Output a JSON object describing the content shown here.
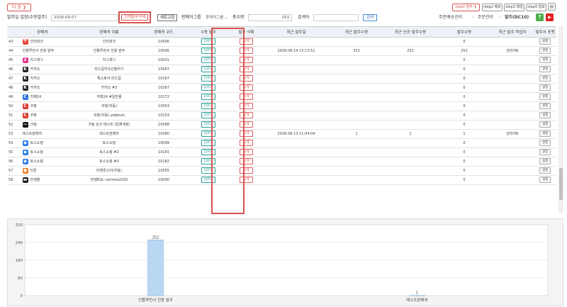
{
  "topbar": {
    "next_label": "다 음 ❯",
    "steps": [
      {
        "label": "step1 발주 ⬆",
        "active": true
      },
      {
        "label": "step2 메모",
        "active": false
      },
      {
        "label": "step3 매칭",
        "active": false
      },
      {
        "label": "step4 합포",
        "active": false
      }
    ]
  },
  "filter": {
    "date_label": "발주일 설정(수동발주)",
    "date_value": "2026-09-07",
    "delete_all_label": "전체발주삭제",
    "refresh_label": "새로고침",
    "group_label": "판매처그룹",
    "group_value": "판매처그룹 ⌄",
    "total_label": "총수량",
    "total_value": "253",
    "search_label": "검색어",
    "search_value": "",
    "search_button": "검색"
  },
  "breadcrumb": {
    "item1": "주문배송관리",
    "sep1": "›",
    "item2": "주문관리",
    "sep2": "›",
    "item3": "발주(DC10)"
  },
  "table": {
    "headers": [
      "판매처",
      "판매처 이름",
      "판매처 코드",
      "수동 발주",
      "발주 삭제",
      "최근 발주일",
      "최근 발주수량",
      "최근 신규 발주수량",
      "발주수량",
      "최근 발주 작업자",
      "발주서 포맷"
    ],
    "upload_label": "업로드",
    "delete_label": "삭제",
    "setting_label": "설정",
    "rows": [
      {
        "no": "43",
        "channel": "인터파크",
        "icon": "interpark-icon",
        "name": "인터파크",
        "code": "10006",
        "date": "",
        "recent": "",
        "new": "",
        "qty": "0",
        "worker": "",
        "color": "#e8473b",
        "glyph": "〒"
      },
      {
        "no": "44",
        "channel": "인플루먼서 전용 발주",
        "icon": "blank-icon",
        "name": "인플루먼서 전용 발주",
        "code": "10095",
        "date": "2026-08-14 13:13:51",
        "recent": "252",
        "new": "252",
        "qty": "252",
        "worker": "관리자6",
        "color": "",
        "glyph": ""
      },
      {
        "no": "45",
        "channel": "지그재그",
        "icon": "zigzag-icon",
        "name": "지그재그",
        "code": "10031",
        "date": "",
        "recent": "",
        "new": "",
        "qty": "0",
        "worker": "",
        "color": "#e0318a",
        "glyph": "Z"
      },
      {
        "no": "46",
        "channel": "카카오",
        "icon": "kakao-icon",
        "name": "미드컵카오선물하기",
        "code": "10067",
        "date": "",
        "recent": "",
        "new": "",
        "qty": "0",
        "worker": "",
        "color": "#222222",
        "glyph": "K"
      },
      {
        "no": "47",
        "channel": "카카오",
        "icon": "kakao-icon",
        "name": "톡스토어 미드컵",
        "code": "10167",
        "date": "",
        "recent": "",
        "new": "",
        "qty": "0",
        "worker": "",
        "color": "#222222",
        "glyph": "K"
      },
      {
        "no": "48",
        "channel": "카카오",
        "icon": "kakao-icon",
        "name": "카카오 #3",
        "code": "10267",
        "date": "",
        "recent": "",
        "new": "",
        "qty": "0",
        "worker": "",
        "color": "#222222",
        "glyph": "K"
      },
      {
        "no": "49",
        "channel": "카페24",
        "icon": "cafe24-icon",
        "name": "카페24 #일반몰",
        "code": "10172",
        "date": "",
        "recent": "",
        "new": "",
        "qty": "0",
        "worker": "",
        "color": "#2a6fdb",
        "glyph": "C"
      },
      {
        "no": "50",
        "channel": "쿠팡",
        "icon": "coupang-icon",
        "name": "쿠팡(자동)",
        "code": "10053",
        "date": "",
        "recent": "",
        "new": "",
        "qty": "0",
        "worker": "",
        "color": "#d9382b",
        "glyph": "C"
      },
      {
        "no": "51",
        "channel": "쿠팡",
        "icon": "coupang-icon",
        "name": "쿠팡(자동) yebbum",
        "code": "10153",
        "date": "",
        "recent": "",
        "new": "",
        "qty": "0",
        "worker": "",
        "color": "#d9382b",
        "glyph": "C"
      },
      {
        "no": "52",
        "channel": "크림",
        "icon": "kream-icon",
        "name": "크림 심크 테스트 (업체계정)",
        "code": "10088",
        "date": "",
        "recent": "",
        "new": "",
        "qty": "0",
        "worker": "",
        "color": "#111111",
        "glyph": "—"
      },
      {
        "no": "53",
        "channel": "테스트판매처",
        "icon": "blank-icon",
        "name": "테스트판매처",
        "code": "10080",
        "date": "2026-08-13 11:04:04",
        "recent": "1",
        "new": "1",
        "qty": "1",
        "worker": "관리자6",
        "color": "",
        "glyph": ""
      },
      {
        "no": "54",
        "channel": "토스쇼핑",
        "icon": "toss-icon",
        "name": "토스쇼핑",
        "code": "10099",
        "date": "",
        "recent": "",
        "new": "",
        "qty": "0",
        "worker": "",
        "color": "#2b7de9",
        "glyph": "◆"
      },
      {
        "no": "55",
        "channel": "토스쇼핑",
        "icon": "toss-icon",
        "name": "토스쇼핑 #2",
        "code": "10181",
        "date": "",
        "recent": "",
        "new": "",
        "qty": "0",
        "worker": "",
        "color": "#2b7de9",
        "glyph": "◆"
      },
      {
        "no": "56",
        "channel": "토스쇼핑",
        "icon": "toss-icon",
        "name": "토스쇼핑 #3",
        "code": "10182",
        "date": "",
        "recent": "",
        "new": "",
        "qty": "0",
        "worker": "",
        "color": "#2b7de9",
        "glyph": "◆"
      },
      {
        "no": "57",
        "channel": "티몬",
        "icon": "tmon-icon",
        "name": "티켓몬스터(자동)",
        "code": "10055",
        "date": "",
        "recent": "",
        "new": "",
        "qty": "0",
        "worker": "",
        "color": "#f07a1d",
        "glyph": "●"
      },
      {
        "no": "58",
        "channel": "한샘몰",
        "icon": "hanssem-icon",
        "name": "한샘EQL carriere2025",
        "code": "10090",
        "date": "",
        "recent": "",
        "new": "",
        "qty": "0",
        "worker": "",
        "color": "#222222",
        "glyph": "▬"
      }
    ]
  },
  "chart_data": {
    "type": "bar",
    "categories": [
      "인플루먼서 전용 발주",
      "테스트판매처"
    ],
    "values": [
      252,
      1
    ],
    "ylim": [
      0,
      320
    ],
    "yticks": [
      "0",
      "80",
      "160",
      "240",
      "320"
    ],
    "bar_color": "#b9d7f3",
    "grid": true
  }
}
